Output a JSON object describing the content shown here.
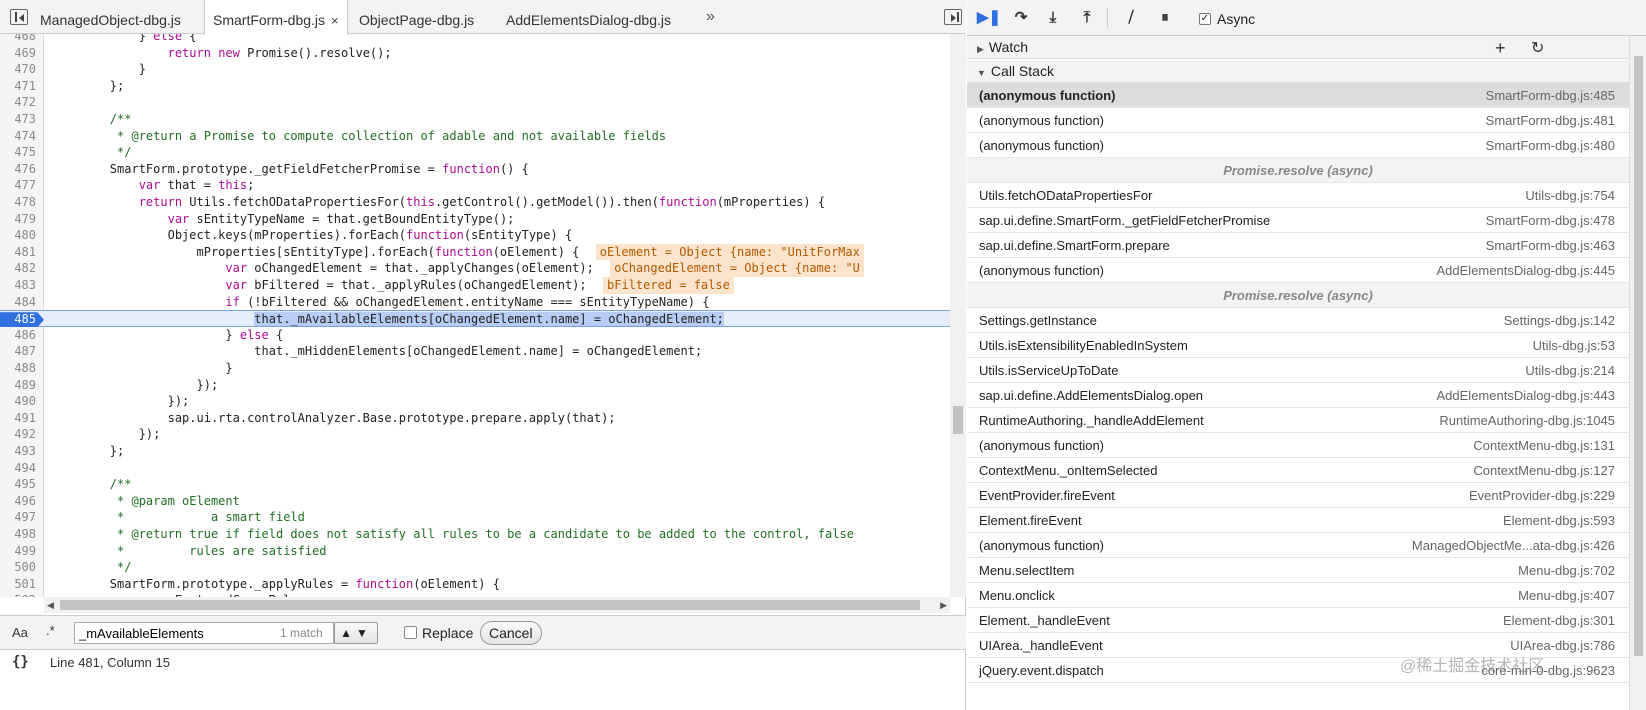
{
  "tabs": [
    {
      "label": "ManagedObject-dbg.js"
    },
    {
      "label": "SmartForm-dbg.js",
      "close": "×"
    },
    {
      "label": "ObjectPage-dbg.js"
    },
    {
      "label": "AddElementsDialog-dbg.js"
    }
  ],
  "tabs_more": "»",
  "code": {
    "current_line": "485",
    "lines": [
      {
        "n": "468",
        "t": "            } else {"
      },
      {
        "n": "469",
        "t": "                return new Promise().resolve();"
      },
      {
        "n": "470",
        "t": "            }"
      },
      {
        "n": "471",
        "t": "        };"
      },
      {
        "n": "472",
        "t": ""
      },
      {
        "n": "473",
        "t": "        /**"
      },
      {
        "n": "474",
        "t": "         * @return a Promise to compute collection of adable and not available fields"
      },
      {
        "n": "475",
        "t": "         */"
      },
      {
        "n": "476",
        "t": "        SmartForm.prototype._getFieldFetcherPromise = function() {"
      },
      {
        "n": "477",
        "t": "            var that = this;"
      },
      {
        "n": "478",
        "t": "            return Utils.fetchODataPropertiesFor(this.getControl().getModel()).then(function(mProperties) {"
      },
      {
        "n": "479",
        "t": "                var sEntityTypeName = that.getBoundEntityType();"
      },
      {
        "n": "480",
        "t": "                Object.keys(mProperties).forEach(function(sEntityType) {"
      },
      {
        "n": "481",
        "t": "                    mProperties[sEntityType].forEach(function(oElement) {"
      },
      {
        "n": "482",
        "t": "                        var oChangedElement = that._applyChanges(oElement);"
      },
      {
        "n": "483",
        "t": "                        var bFiltered = that._applyRules(oChangedElement);"
      },
      {
        "n": "484",
        "t": "                        if (!bFiltered && oChangedElement.entityName === sEntityTypeName) {"
      },
      {
        "n": "485",
        "t": "                            that._mAvailableElements[oChangedElement.name] = oChangedElement;"
      },
      {
        "n": "486",
        "t": "                        } else {"
      },
      {
        "n": "487",
        "t": "                            that._mHiddenElements[oChangedElement.name] = oChangedElement;"
      },
      {
        "n": "488",
        "t": "                        }"
      },
      {
        "n": "489",
        "t": "                    });"
      },
      {
        "n": "490",
        "t": "                });"
      },
      {
        "n": "491",
        "t": "                sap.ui.rta.controlAnalyzer.Base.prototype.prepare.apply(that);"
      },
      {
        "n": "492",
        "t": "            });"
      },
      {
        "n": "493",
        "t": "        };"
      },
      {
        "n": "494",
        "t": ""
      },
      {
        "n": "495",
        "t": "        /**"
      },
      {
        "n": "496",
        "t": "         * @param oElement"
      },
      {
        "n": "497",
        "t": "         *            a smart field"
      },
      {
        "n": "498",
        "t": "         * @return true if field does not satisfy all rules to be a candidate to be added to the control, false"
      },
      {
        "n": "499",
        "t": "         *         rules are satisfied"
      },
      {
        "n": "500",
        "t": "         */"
      },
      {
        "n": "501",
        "t": "        SmartForm.prototype._applyRules = function(oElement) {"
      },
      {
        "n": "502",
        "t": "            var oFeaturedGroupRules"
      }
    ],
    "inline_values": [
      {
        "line": "481",
        "text": "oElement = Object {name: \"UnitForMax"
      },
      {
        "line": "482",
        "text": "oChangedElement = Object {name: \"U"
      },
      {
        "line": "483",
        "text": "bFiltered = false"
      }
    ]
  },
  "search": {
    "case_label": "Aa",
    "regex_label": ".*",
    "value": "_mAvailableElements",
    "count": "1 match",
    "nav": "▲▼",
    "replace_label": "Replace",
    "cancel_label": "Cancel"
  },
  "status": {
    "pretty_print": "{}",
    "position": "Line 481, Column 15"
  },
  "debugger": {
    "async_label": "Async",
    "async_checked": "✓",
    "watch_label": "Watch",
    "watch_add": "+",
    "watch_refresh": "↻",
    "callstack_label": "Call Stack",
    "frames": [
      {
        "kind": "frame",
        "fn": "(anonymous function)",
        "loc": "SmartForm-dbg.js:485",
        "selected": true
      },
      {
        "kind": "frame",
        "fn": "(anonymous function)",
        "loc": "SmartForm-dbg.js:481"
      },
      {
        "kind": "frame",
        "fn": "(anonymous function)",
        "loc": "SmartForm-dbg.js:480"
      },
      {
        "kind": "async",
        "fn": "Promise.resolve (async)"
      },
      {
        "kind": "frame",
        "fn": "Utils.fetchODataPropertiesFor",
        "loc": "Utils-dbg.js:754"
      },
      {
        "kind": "frame",
        "fn": "sap.ui.define.SmartForm._getFieldFetcherPromise",
        "loc": "SmartForm-dbg.js:478"
      },
      {
        "kind": "frame",
        "fn": "sap.ui.define.SmartForm.prepare",
        "loc": "SmartForm-dbg.js:463"
      },
      {
        "kind": "frame",
        "fn": "(anonymous function)",
        "loc": "AddElementsDialog-dbg.js:445"
      },
      {
        "kind": "async",
        "fn": "Promise.resolve (async)"
      },
      {
        "kind": "frame",
        "fn": "Settings.getInstance",
        "loc": "Settings-dbg.js:142"
      },
      {
        "kind": "frame",
        "fn": "Utils.isExtensibilityEnabledInSystem",
        "loc": "Utils-dbg.js:53"
      },
      {
        "kind": "frame",
        "fn": "Utils.isServiceUpToDate",
        "loc": "Utils-dbg.js:214"
      },
      {
        "kind": "frame",
        "fn": "sap.ui.define.AddElementsDialog.open",
        "loc": "AddElementsDialog-dbg.js:443"
      },
      {
        "kind": "frame",
        "fn": "RuntimeAuthoring._handleAddElement",
        "loc": "RuntimeAuthoring-dbg.js:1045"
      },
      {
        "kind": "frame",
        "fn": "(anonymous function)",
        "loc": "ContextMenu-dbg.js:131"
      },
      {
        "kind": "frame",
        "fn": "ContextMenu._onItemSelected",
        "loc": "ContextMenu-dbg.js:127"
      },
      {
        "kind": "frame",
        "fn": "EventProvider.fireEvent",
        "loc": "EventProvider-dbg.js:229"
      },
      {
        "kind": "frame",
        "fn": "Element.fireEvent",
        "loc": "Element-dbg.js:593"
      },
      {
        "kind": "frame",
        "fn": "(anonymous function)",
        "loc": "ManagedObjectMe...ata-dbg.js:426"
      },
      {
        "kind": "frame",
        "fn": "Menu.selectItem",
        "loc": "Menu-dbg.js:702"
      },
      {
        "kind": "frame",
        "fn": "Menu.onclick",
        "loc": "Menu-dbg.js:407"
      },
      {
        "kind": "frame",
        "fn": "Element._handleEvent",
        "loc": "Element-dbg.js:301"
      },
      {
        "kind": "frame",
        "fn": "UIArea._handleEvent",
        "loc": "UIArea-dbg.js:786"
      },
      {
        "kind": "frame",
        "fn": "jQuery.event.dispatch",
        "loc": "core-min-0-dbg.js:9623"
      }
    ]
  },
  "watermark": "@稀土掘金技术社区"
}
